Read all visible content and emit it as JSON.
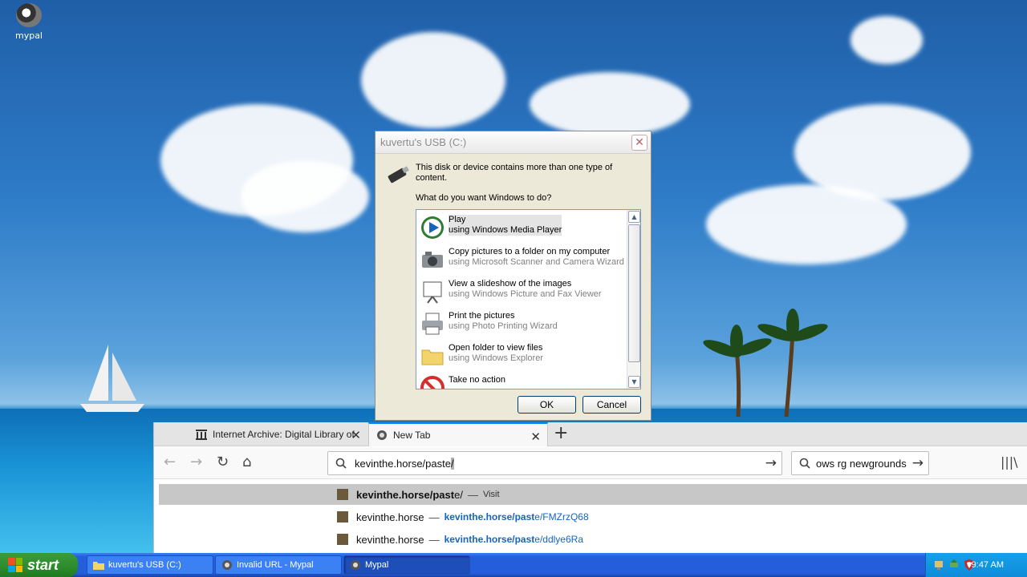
{
  "desktop": {
    "icons": [
      {
        "label": "mypal"
      }
    ]
  },
  "dialog": {
    "title": "kuvertu's USB (C:)",
    "message": "This disk or device contains more than one type of content.",
    "question": "What do you want Windows to do?",
    "options": [
      {
        "title": "Play",
        "subtitle": "using Windows Media Player",
        "icon": "media-player-icon",
        "selected": true
      },
      {
        "title": "Copy pictures to a folder on my computer",
        "subtitle": "using Microsoft Scanner and Camera Wizard",
        "icon": "camera-icon"
      },
      {
        "title": "View a slideshow of the images",
        "subtitle": "using Windows Picture and Fax Viewer",
        "icon": "slideshow-icon"
      },
      {
        "title": "Print the pictures",
        "subtitle": "using Photo Printing Wizard",
        "icon": "printer-icon"
      },
      {
        "title": "Open folder to view files",
        "subtitle": "using Windows Explorer",
        "icon": "folder-icon"
      },
      {
        "title": "Take no action",
        "subtitle": "",
        "icon": "no-action-icon"
      }
    ],
    "ok_label": "OK",
    "cancel_label": "Cancel"
  },
  "browser": {
    "tabs": [
      {
        "label": "Internet Archive: Digital Library of",
        "active": false
      },
      {
        "label": "New Tab",
        "active": true
      }
    ],
    "url": {
      "typed": "kevinthe.horse/paste",
      "autocomplete": "/"
    },
    "search_value": "ows rg newgrounds",
    "suggestions": [
      {
        "host_bold": "kevinthe.horse/past",
        "rest": "e/",
        "sep": "—",
        "action": "Visit",
        "highlighted": true
      },
      {
        "host": "kevinthe.horse",
        "sep": "—",
        "link_bold": "kevinthe.horse/past",
        "link_rest": "e/FMZrzQ68"
      },
      {
        "host": "kevinthe.horse",
        "sep": "—",
        "link_bold": "kevinthe.horse/past",
        "link_rest": "e/ddlye6Ra"
      }
    ]
  },
  "taskbar": {
    "start_label": "start",
    "items": [
      {
        "label": "kuvertu's USB (C:)",
        "icon": "folder-icon"
      },
      {
        "label": "Invalid URL - Mypal",
        "icon": "mypal-icon"
      },
      {
        "label": "Mypal",
        "icon": "mypal-icon",
        "active": true
      }
    ],
    "clock": "9:47 AM"
  }
}
